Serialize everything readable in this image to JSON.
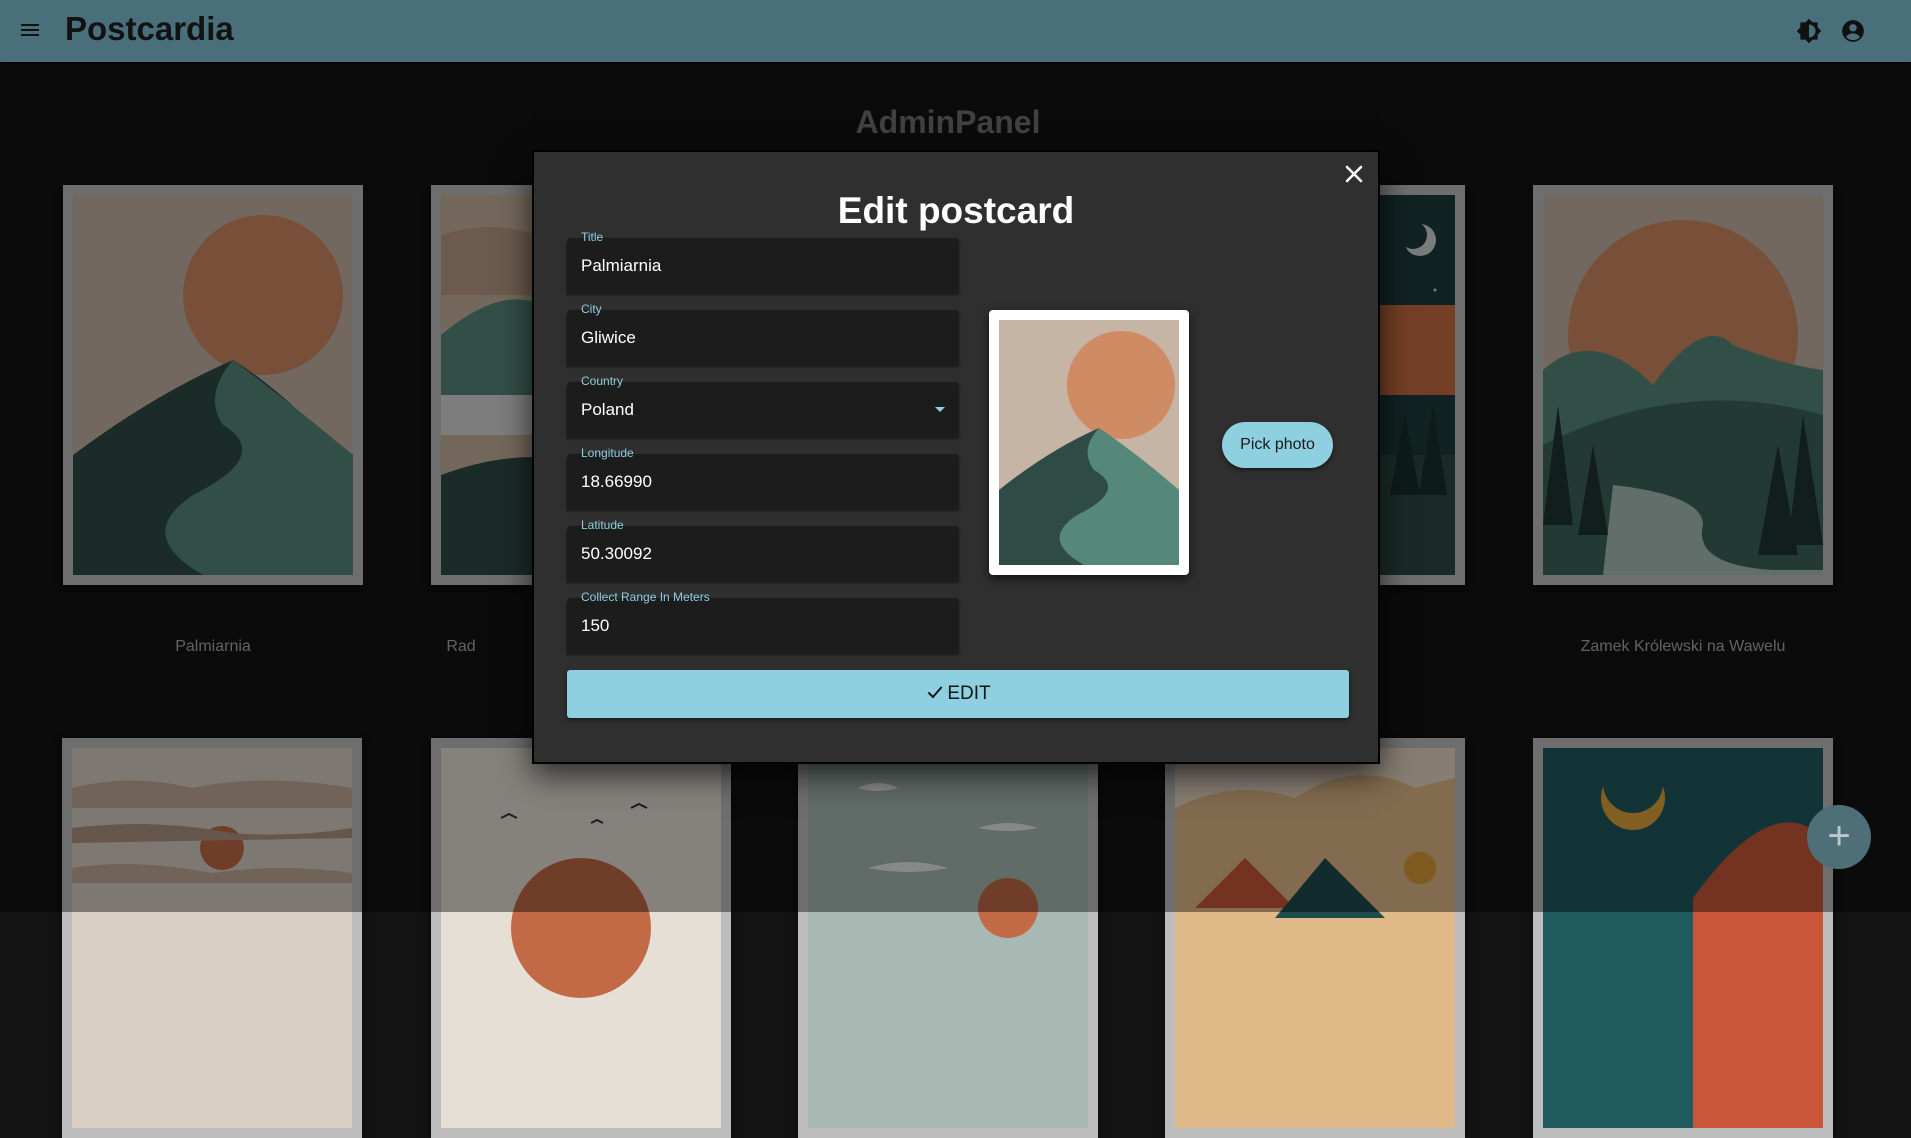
{
  "header": {
    "app_title": "Postcardia",
    "menu_icon": "menu-icon",
    "theme_icon": "brightness-icon",
    "account_icon": "account-circle-icon",
    "background_color": "#49707a"
  },
  "page": {
    "title": "AdminPanel"
  },
  "cards": [
    {
      "caption": "Palmiarnia",
      "theme": "sun-mountain"
    },
    {
      "caption": "Rad",
      "theme": "layered-hills"
    },
    {
      "caption": "",
      "theme": "hidden"
    },
    {
      "caption": "",
      "theme": "night-moon"
    },
    {
      "caption": "Zamek Królewski na Wawelu",
      "theme": "pine-valley"
    },
    {
      "caption": "",
      "theme": "cloudy-sunset"
    },
    {
      "caption": "",
      "theme": "birds-sun"
    },
    {
      "caption": "",
      "theme": "grey-clouds"
    },
    {
      "caption": "",
      "theme": "desert-peaks"
    },
    {
      "caption": "",
      "theme": "teal-moon"
    }
  ],
  "dialog": {
    "title": "Edit postcard",
    "close_icon": "close-icon",
    "fields": {
      "title": {
        "label": "Title",
        "value": "Palmiarnia"
      },
      "city": {
        "label": "City",
        "value": "Gliwice"
      },
      "country": {
        "label": "Country",
        "value": "Poland"
      },
      "longitude": {
        "label": "Longitude",
        "value": "18.66990"
      },
      "latitude": {
        "label": "Latitude",
        "value": "50.30092"
      },
      "range": {
        "label": "Collect Range In Meters",
        "value": "150"
      }
    },
    "pick_photo_label": "Pick photo",
    "submit_label": "EDIT",
    "submit_icon": "check-icon",
    "accent_color": "#8ecfe0"
  },
  "fab": {
    "icon": "plus-icon",
    "label": "+"
  }
}
